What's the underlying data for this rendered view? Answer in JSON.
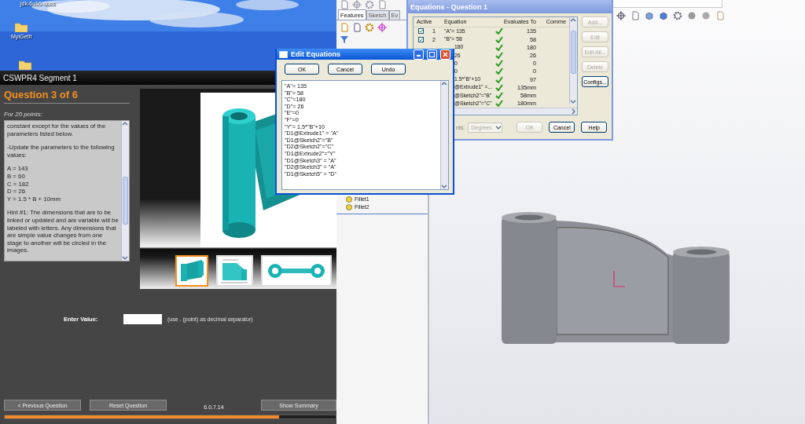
{
  "desktop": {
    "icons": [
      {
        "label": "jdk-6u10-docs"
      },
      {
        "label": "MyIGetIt"
      }
    ]
  },
  "tutor": {
    "title": "CSWPR4 Segment 1",
    "heading": "Question 3 of 6",
    "points": "For 20 points:",
    "paragraphs": [
      [
        "constant except for the values of the parameters listed below."
      ],
      [
        "-Update the parameters to the following values:"
      ],
      [
        "A = 143",
        "B = 60",
        "C = 182",
        "D = 26",
        "Y = 1.5 * B + 10mm"
      ],
      [
        "Hint #1: The dimensions that are to be linked or updated and are variable will be labeled with letters. Any dimensions that are simple value changes from one stage to another will be circled in the images."
      ]
    ],
    "thumbnails": [
      {
        "selected": true
      },
      {
        "selected": false
      },
      {
        "selected": false
      }
    ],
    "value_label": "Enter Value:",
    "value_hint": "(use . (point) as decimal separator)",
    "buttons": [
      "< Previous Question",
      "Reset Question"
    ],
    "version": "6.0.7.14",
    "summary_button": "Show Summary",
    "progress": {
      "level": 0.83
    }
  },
  "solidworks": {
    "tabs": [
      {
        "label": "Features",
        "selected": true
      },
      {
        "label": "Sketch",
        "selected": false
      },
      {
        "label": "Ev",
        "selected": false
      }
    ],
    "tree": [
      {
        "label": "Fillet1"
      },
      {
        "label": "Fillet2"
      }
    ]
  },
  "equations_dialog": {
    "title": "Equations - Question 1",
    "columns": [
      "Active",
      "Equation",
      "Evaluates To",
      "Comme"
    ],
    "rows": [
      {
        "kind": "full",
        "checked": true,
        "number": "1",
        "equation": "\"A\"= 135",
        "value": "135"
      },
      {
        "kind": "full",
        "checked": true,
        "number": "2",
        "equation": "\"B\"= 58",
        "value": "58"
      },
      {
        "kind": "partial",
        "equation": "180",
        "value": "180"
      },
      {
        "kind": "partial",
        "equation": "26",
        "value": "26"
      },
      {
        "kind": "partial",
        "equation": "0",
        "value": "0"
      },
      {
        "kind": "partial",
        "equation": "0",
        "value": "0"
      },
      {
        "kind": "partial",
        "equation": "1.5*\"B\"+10",
        "value": "97"
      },
      {
        "kind": "partial",
        "equation": "@Extrude1\" =...",
        "value": "135mm"
      },
      {
        "kind": "partial",
        "equation": "@Sketch2\"=\"B\"",
        "value": "58mm"
      },
      {
        "kind": "partial",
        "equation": "@Sketch2\"=\"C\"",
        "value": "180mm"
      }
    ],
    "side_buttons": [
      {
        "label": "Add...",
        "disabled": true
      },
      {
        "label": "Edit",
        "disabled": true
      },
      {
        "label": "Edit All...",
        "disabled": true
      },
      {
        "label": "Delete",
        "disabled": true
      },
      {
        "label": "Configs...",
        "disabled": false
      }
    ],
    "units_label": "nts:",
    "units_value": "Degrees",
    "buttons": [
      {
        "label": "OK",
        "disabled": true
      },
      {
        "label": "Cancel",
        "disabled": false
      },
      {
        "label": "Help",
        "disabled": false
      }
    ]
  },
  "edit_dialog": {
    "title": "Edit Equations",
    "buttons": [
      "OK",
      "Cancel",
      "Undo"
    ],
    "lines": [
      "\"A\"= 135",
      "\"B\"= 58",
      "\"C\"=180",
      "\"D\"= 26",
      "\"E\"=0",
      "\"F\"=0",
      "\"Y\"= 1.5*\"B\"+10",
      "\"D1@Extrude1\" = \"A\"",
      "\"D1@Sketch2\"=\"B\"",
      "\"D2@Sketch2\"=\"C\"",
      "\"D1@Extrude2\"=\"Y\"",
      "\"D1@Sketch3\" = \"A\"",
      "\"D2@Sketch3\" = \"A\"",
      "\"D1@Sketch5\" = \"D\""
    ]
  }
}
